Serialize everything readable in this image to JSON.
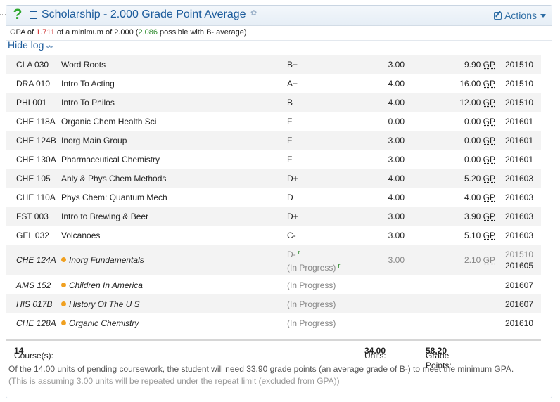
{
  "header": {
    "title": "Scholarship - 2.000 Grade Point Average",
    "actions_label": "Actions"
  },
  "summary": {
    "prefix": "GPA of",
    "gpa": "1.711",
    "mid": "of a minimum of 2.000 (",
    "possible": "2.086",
    "suffix": "possible with B- average)"
  },
  "hide_log_label": "Hide log",
  "rows": [
    {
      "code": "CLA 030",
      "title": "Word Roots",
      "grade": "B+",
      "units": "3.00",
      "gp": "9.90",
      "gp_unit": "GP",
      "term": "201510"
    },
    {
      "code": "DRA 010",
      "title": "Intro To Acting",
      "grade": "A+",
      "units": "4.00",
      "gp": "16.00",
      "gp_unit": "GP",
      "term": "201510"
    },
    {
      "code": "PHI 001",
      "title": "Intro To Philos",
      "grade": "B",
      "units": "4.00",
      "gp": "12.00",
      "gp_unit": "GP",
      "term": "201510"
    },
    {
      "code": "CHE 118A",
      "title": "Organic Chem Health Sci",
      "grade": "F",
      "units": "0.00",
      "gp": "0.00",
      "gp_unit": "GP",
      "term": "201601"
    },
    {
      "code": "CHE 124B",
      "title": "Inorg Main Group",
      "grade": "F",
      "units": "3.00",
      "gp": "0.00",
      "gp_unit": "GP",
      "term": "201601"
    },
    {
      "code": "CHE 130A",
      "title": "Pharmaceutical Chemistry",
      "grade": "F",
      "units": "3.00",
      "gp": "0.00",
      "gp_unit": "GP",
      "term": "201601"
    },
    {
      "code": "CHE 105",
      "title": "Anly & Phys Chem Methods",
      "grade": "D+",
      "units": "4.00",
      "gp": "5.20",
      "gp_unit": "GP",
      "term": "201603"
    },
    {
      "code": "CHE 110A",
      "title": "Phys Chem: Quantum Mech",
      "grade": "D",
      "units": "4.00",
      "gp": "4.00",
      "gp_unit": "GP",
      "term": "201603"
    },
    {
      "code": "FST 003",
      "title": "Intro to Brewing & Beer",
      "grade": "D+",
      "units": "3.00",
      "gp": "3.90",
      "gp_unit": "GP",
      "term": "201603"
    },
    {
      "code": "GEL 032",
      "title": "Volcanoes",
      "grade": "C-",
      "units": "3.00",
      "gp": "5.10",
      "gp_unit": "GP",
      "term": "201603"
    }
  ],
  "repeat_row": {
    "code": "CHE 124A",
    "title": "Inorg Fundamentals",
    "grade": "D-",
    "tick": "r",
    "status": "(In Progress)",
    "units": "3.00",
    "gp": "2.10",
    "gp_unit": "GP",
    "term_old": "201510",
    "term_new": "201605"
  },
  "in_progress": [
    {
      "code": "AMS 152",
      "title": "Children In America",
      "status": "(In Progress)",
      "term": "201607"
    },
    {
      "code": "HIS 017B",
      "title": "History Of The U S",
      "status": "(In Progress)",
      "term": "201607"
    },
    {
      "code": "CHE 128A",
      "title": "Organic Chemistry",
      "status": "(In Progress)",
      "term": "201610"
    }
  ],
  "footer": {
    "courses_label": "Course(s):",
    "courses": "14",
    "units_label": "Units:",
    "units": "34.00",
    "gp_label": "Grade Points:",
    "gp": "58.20"
  },
  "note": {
    "line1": "Of the 14.00 units of pending coursework, the student will need 33.90 grade points (an average grade of B-) to meet the minimum GPA.",
    "line2": "(This is assuming 3.00 units will be repeated under the repeat limit (excluded from GPA))"
  },
  "colors": {
    "accent": "#1d5c9c",
    "gpa_red": "#cc2222",
    "gpa_green": "#2d8a2d",
    "in_progress_dot": "#f0a020"
  }
}
